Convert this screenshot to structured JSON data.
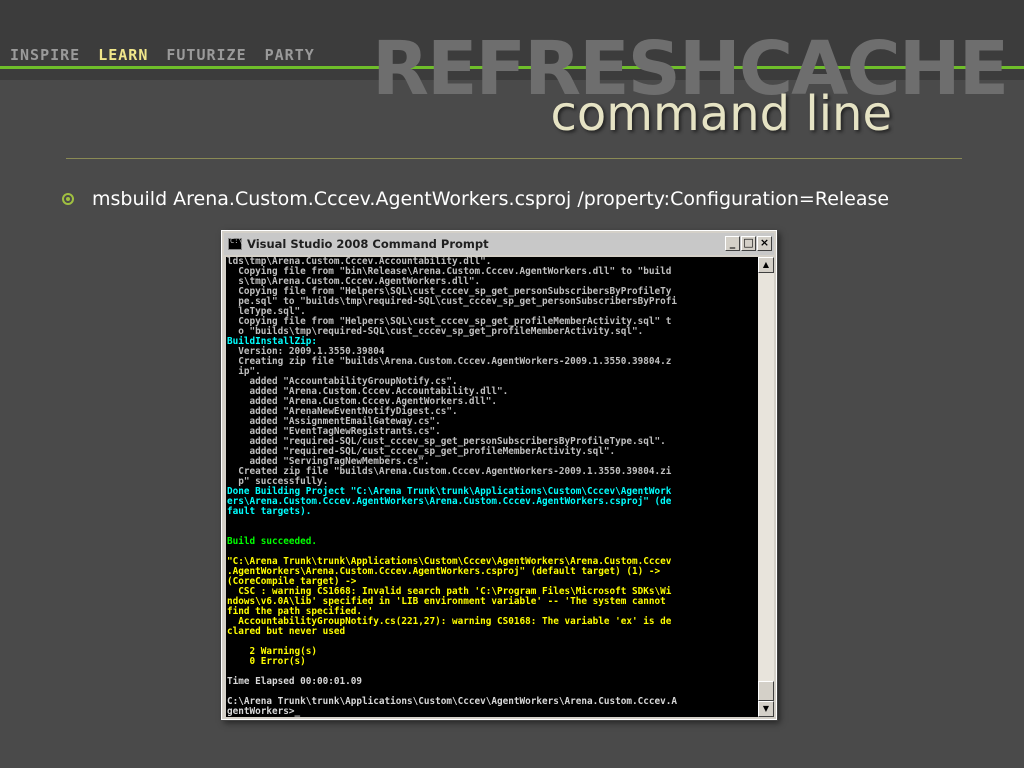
{
  "header": {
    "nav": [
      "INSPIRE",
      "LEARN",
      "FUTURIZE",
      "PARTY"
    ],
    "nav_active": "LEARN",
    "brand": "REFRESHCACHE",
    "subtitle": "command line"
  },
  "bullet": {
    "text": "msbuild Arena.Custom.Cccev.AgentWorkers.csproj /property:Configuration=Release"
  },
  "window": {
    "title": "Visual Studio 2008 Command Prompt",
    "controls": [
      "_",
      "□",
      "×"
    ]
  },
  "console_lines": [
    {
      "c": "gray",
      "t": "lds\\tmp\\Arena.Custom.Cccev.Accountability.dll\"."
    },
    {
      "c": "gray",
      "t": "  Copying file from \"bin\\Release\\Arena.Custom.Cccev.AgentWorkers.dll\" to \"build"
    },
    {
      "c": "gray",
      "t": "  s\\tmp\\Arena.Custom.Cccev.AgentWorkers.dll\"."
    },
    {
      "c": "gray",
      "t": "  Copying file from \"Helpers\\SQL\\cust_cccev_sp_get_personSubscribersByProfileTy"
    },
    {
      "c": "gray",
      "t": "  pe.sql\" to \"builds\\tmp\\required-SQL\\cust_cccev_sp_get_personSubscribersByProfi"
    },
    {
      "c": "gray",
      "t": "  leType.sql\"."
    },
    {
      "c": "gray",
      "t": "  Copying file from \"Helpers\\SQL\\cust_cccev_sp_get_profileMemberActivity.sql\" t"
    },
    {
      "c": "gray",
      "t": "  o \"builds\\tmp\\required-SQL\\cust_cccev_sp_get_profileMemberActivity.sql\"."
    },
    {
      "c": "cyan",
      "t": "BuildInstallZip:"
    },
    {
      "c": "gray",
      "t": "  Version: 2009.1.3550.39804"
    },
    {
      "c": "gray",
      "t": "  Creating zip file \"builds\\Arena.Custom.Cccev.AgentWorkers-2009.1.3550.39804.z"
    },
    {
      "c": "gray",
      "t": "  ip\"."
    },
    {
      "c": "gray",
      "t": "    added \"AccountabilityGroupNotify.cs\"."
    },
    {
      "c": "gray",
      "t": "    added \"Arena.Custom.Cccev.Accountability.dll\"."
    },
    {
      "c": "gray",
      "t": "    added \"Arena.Custom.Cccev.AgentWorkers.dll\"."
    },
    {
      "c": "gray",
      "t": "    added \"ArenaNewEventNotifyDigest.cs\"."
    },
    {
      "c": "gray",
      "t": "    added \"AssignmentEmailGateway.cs\"."
    },
    {
      "c": "gray",
      "t": "    added \"EventTagNewRegistrants.cs\"."
    },
    {
      "c": "gray",
      "t": "    added \"required-SQL/cust_cccev_sp_get_personSubscribersByProfileType.sql\"."
    },
    {
      "c": "gray",
      "t": "    added \"required-SQL/cust_cccev_sp_get_profileMemberActivity.sql\"."
    },
    {
      "c": "gray",
      "t": "    added \"ServingTagNewMembers.cs\"."
    },
    {
      "c": "gray",
      "t": "  Created zip file \"builds\\Arena.Custom.Cccev.AgentWorkers-2009.1.3550.39804.zi"
    },
    {
      "c": "gray",
      "t": "  p\" successfully."
    },
    {
      "c": "cyan",
      "t": "Done Building Project \"C:\\Arena Trunk\\trunk\\Applications\\Custom\\Cccev\\AgentWork"
    },
    {
      "c": "cyan",
      "t": "ers\\Arena.Custom.Cccev.AgentWorkers\\Arena.Custom.Cccev.AgentWorkers.csproj\" (de"
    },
    {
      "c": "cyan",
      "t": "fault targets)."
    },
    {
      "c": "gray",
      "t": ""
    },
    {
      "c": "gray",
      "t": ""
    },
    {
      "c": "green",
      "t": "Build succeeded."
    },
    {
      "c": "gray",
      "t": ""
    },
    {
      "c": "yellow",
      "t": "\"C:\\Arena Trunk\\trunk\\Applications\\Custom\\Cccev\\AgentWorkers\\Arena.Custom.Cccev"
    },
    {
      "c": "yellow",
      "t": ".AgentWorkers\\Arena.Custom.Cccev.AgentWorkers.csproj\" (default target) (1) ->"
    },
    {
      "c": "yellow",
      "t": "(CoreCompile target) ->"
    },
    {
      "c": "yellow",
      "t": "  CSC : warning CS1668: Invalid search path 'C:\\Program Files\\Microsoft SDKs\\Wi"
    },
    {
      "c": "yellow",
      "t": "ndows\\v6.0A\\lib' specified in 'LIB environment variable' -- 'The system cannot"
    },
    {
      "c": "yellow",
      "t": "find the path specified. '"
    },
    {
      "c": "yellow",
      "t": "  AccountabilityGroupNotify.cs(221,27): warning CS0168: The variable 'ex' is de"
    },
    {
      "c": "yellow",
      "t": "clared but never used"
    },
    {
      "c": "gray",
      "t": ""
    },
    {
      "c": "yellow",
      "t": "    2 Warning(s)"
    },
    {
      "c": "yellow",
      "t": "    0 Error(s)"
    },
    {
      "c": "gray",
      "t": ""
    },
    {
      "c": "white",
      "t": "Time Elapsed 00:00:01.09"
    },
    {
      "c": "gray",
      "t": ""
    },
    {
      "c": "white",
      "t": "C:\\Arena Trunk\\trunk\\Applications\\Custom\\Cccev\\AgentWorkers\\Arena.Custom.Cccev.A"
    },
    {
      "c": "white",
      "t": "gentWorkers>_"
    }
  ],
  "colors": {
    "nav_active": "#f0e68a",
    "accent_line": "#6fbe2a",
    "subtitle": "#e6e3c4"
  }
}
